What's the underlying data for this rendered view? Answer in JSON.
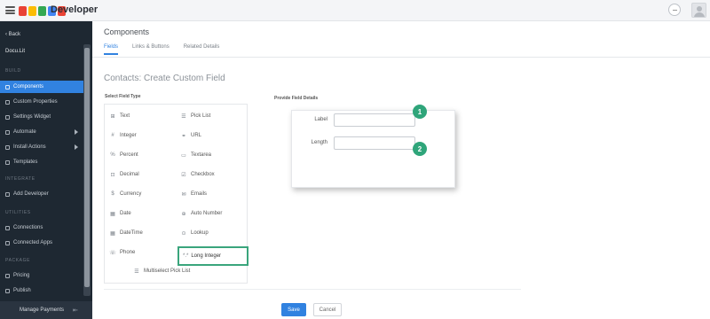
{
  "header": {
    "brand": "Developer",
    "logo_colors": [
      "#e94235",
      "#fbbc04",
      "#34a853",
      "#4285f4",
      "#ea4335"
    ]
  },
  "sidebar": {
    "back_label": "‹ Back",
    "app_name": "Docu.Lit",
    "sections": {
      "build": "BUILD",
      "integrate": "INTEGRATE",
      "utilities": "UTILITIES",
      "package": "PACKAGE"
    },
    "build_items": [
      {
        "label": "Components",
        "icon": "components-icon",
        "active": true
      },
      {
        "label": "Custom Properties",
        "icon": "properties-icon"
      },
      {
        "label": "Settings Widget",
        "icon": "settings-icon"
      },
      {
        "label": "Automate",
        "icon": "automate-icon",
        "caret": true
      },
      {
        "label": "Install Actions",
        "icon": "install-icon",
        "caret": true
      },
      {
        "label": "Templates",
        "icon": "templates-icon"
      }
    ],
    "integrate_items": [
      {
        "label": "Add Developer",
        "icon": "add-developer-icon"
      }
    ],
    "utilities_items": [
      {
        "label": "Connections",
        "icon": "connections-icon"
      },
      {
        "label": "Connected Apps",
        "icon": "connected-apps-icon"
      }
    ],
    "package_items": [
      {
        "label": "Pricing",
        "icon": "pricing-icon"
      },
      {
        "label": "Publish",
        "icon": "publish-icon"
      }
    ],
    "bottom_label": "Manage Payments"
  },
  "main": {
    "title": "Components",
    "tabs": [
      {
        "label": "Fields",
        "active": true
      },
      {
        "label": "Links & Buttons"
      },
      {
        "label": "Related Details"
      }
    ],
    "section_title": "Contacts: Create Custom Field",
    "select_label": "Select Field Type",
    "field_types": [
      {
        "label": "Text",
        "icon": "text-icon",
        "glyph": "⊞"
      },
      {
        "label": "Pick List",
        "icon": "pick-list-icon",
        "glyph": "☰"
      },
      {
        "label": "Integer",
        "icon": "integer-icon",
        "glyph": "#"
      },
      {
        "label": "URL",
        "icon": "url-icon",
        "glyph": "⚭"
      },
      {
        "label": "Percent",
        "icon": "percent-icon",
        "glyph": "%"
      },
      {
        "label": "Textarea",
        "icon": "textarea-icon",
        "glyph": "▭"
      },
      {
        "label": "Decimal",
        "icon": "decimal-icon",
        "glyph": "⊡"
      },
      {
        "label": "Checkbox",
        "icon": "checkbox-icon",
        "glyph": "☑"
      },
      {
        "label": "Currency",
        "icon": "currency-icon",
        "glyph": "$"
      },
      {
        "label": "Emails",
        "icon": "emails-icon",
        "glyph": "✉"
      },
      {
        "label": "Date",
        "icon": "date-icon",
        "glyph": "▦"
      },
      {
        "label": "Auto Number",
        "icon": "auto-number-icon",
        "glyph": "⊕"
      },
      {
        "label": "DateTime",
        "icon": "datetime-icon",
        "glyph": "▦"
      },
      {
        "label": "Lookup",
        "icon": "lookup-icon",
        "glyph": "⊙"
      },
      {
        "label": "Phone",
        "icon": "phone-icon",
        "glyph": "☏"
      }
    ],
    "highlighted_type": {
      "label": "Long Integer",
      "glyph": "*.*"
    },
    "multiselect": {
      "label": "Multiselect Pick List",
      "glyph": "☰"
    },
    "provide_label": "Provide Field Details",
    "details": {
      "label_label": "Label",
      "label_value": "",
      "length_label": "Length",
      "length_value": "",
      "badge1": "1",
      "badge2": "2"
    },
    "buttons": {
      "save": "Save",
      "cancel": "Cancel"
    }
  },
  "colors": {
    "accent": "#3182e0",
    "highlight": "#3aa57c",
    "badge": "#2fa57a",
    "sidebar_bg": "#1e2832"
  }
}
